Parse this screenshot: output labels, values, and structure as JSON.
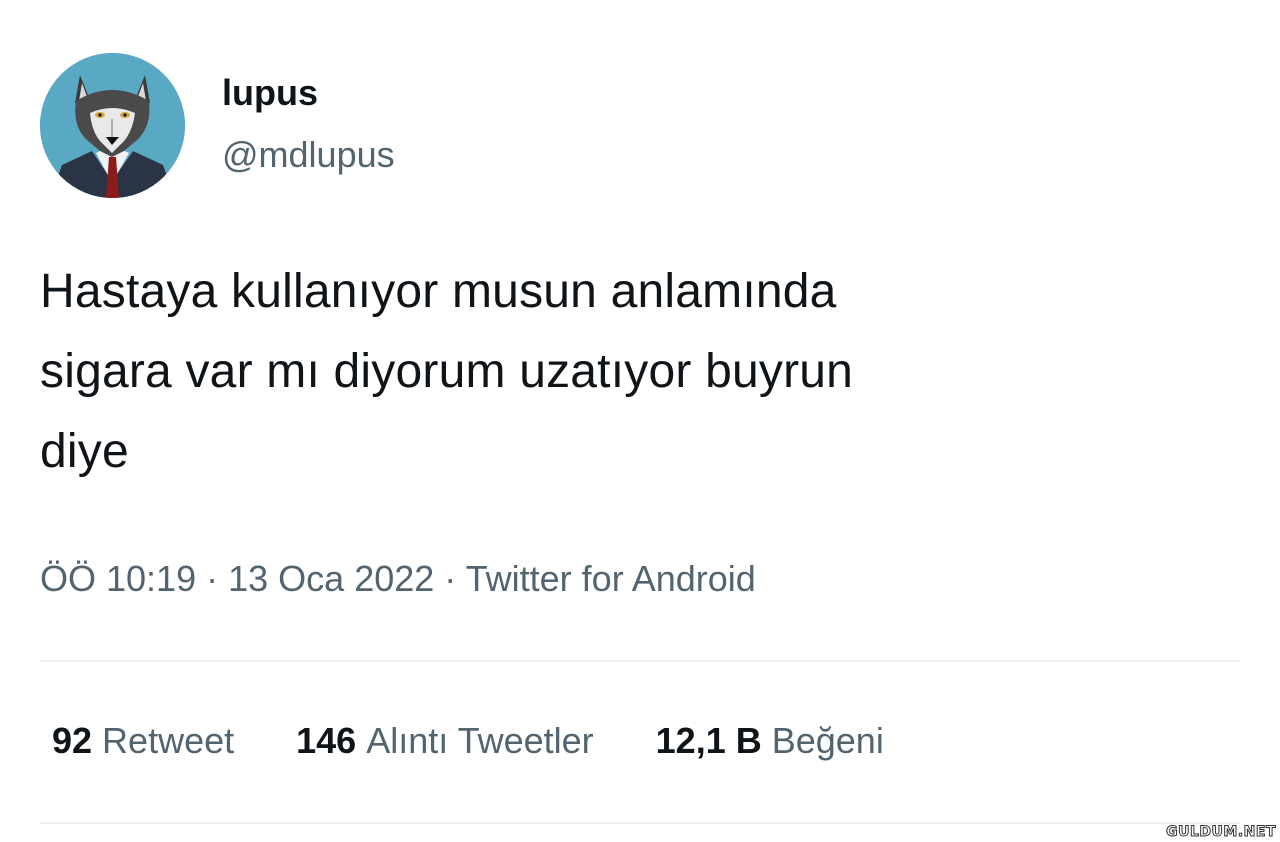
{
  "author": {
    "display_name": "lupus",
    "handle": "@mdlupus",
    "avatar_icon": "wolf-in-suit-avatar"
  },
  "tweet": {
    "text": "Hastaya kullanıyor musun anlamında\nsigara var mı diyorum uzatıyor buyrun\ndiye",
    "time": "ÖÖ 10:19",
    "separator": "·",
    "date": "13 Oca 2022",
    "source": "Twitter for Android"
  },
  "stats": [
    {
      "count": "92",
      "label": "Retweet"
    },
    {
      "count": "146",
      "label": "Alıntı Tweetler"
    },
    {
      "count": "12,1 B",
      "label": "Beğeni"
    }
  ],
  "watermark": "GULDUM.NET",
  "colors": {
    "text_primary": "#0f1419",
    "text_secondary": "#536471",
    "divider": "#eff3f4",
    "avatar_bg": "#5aa9c4"
  }
}
